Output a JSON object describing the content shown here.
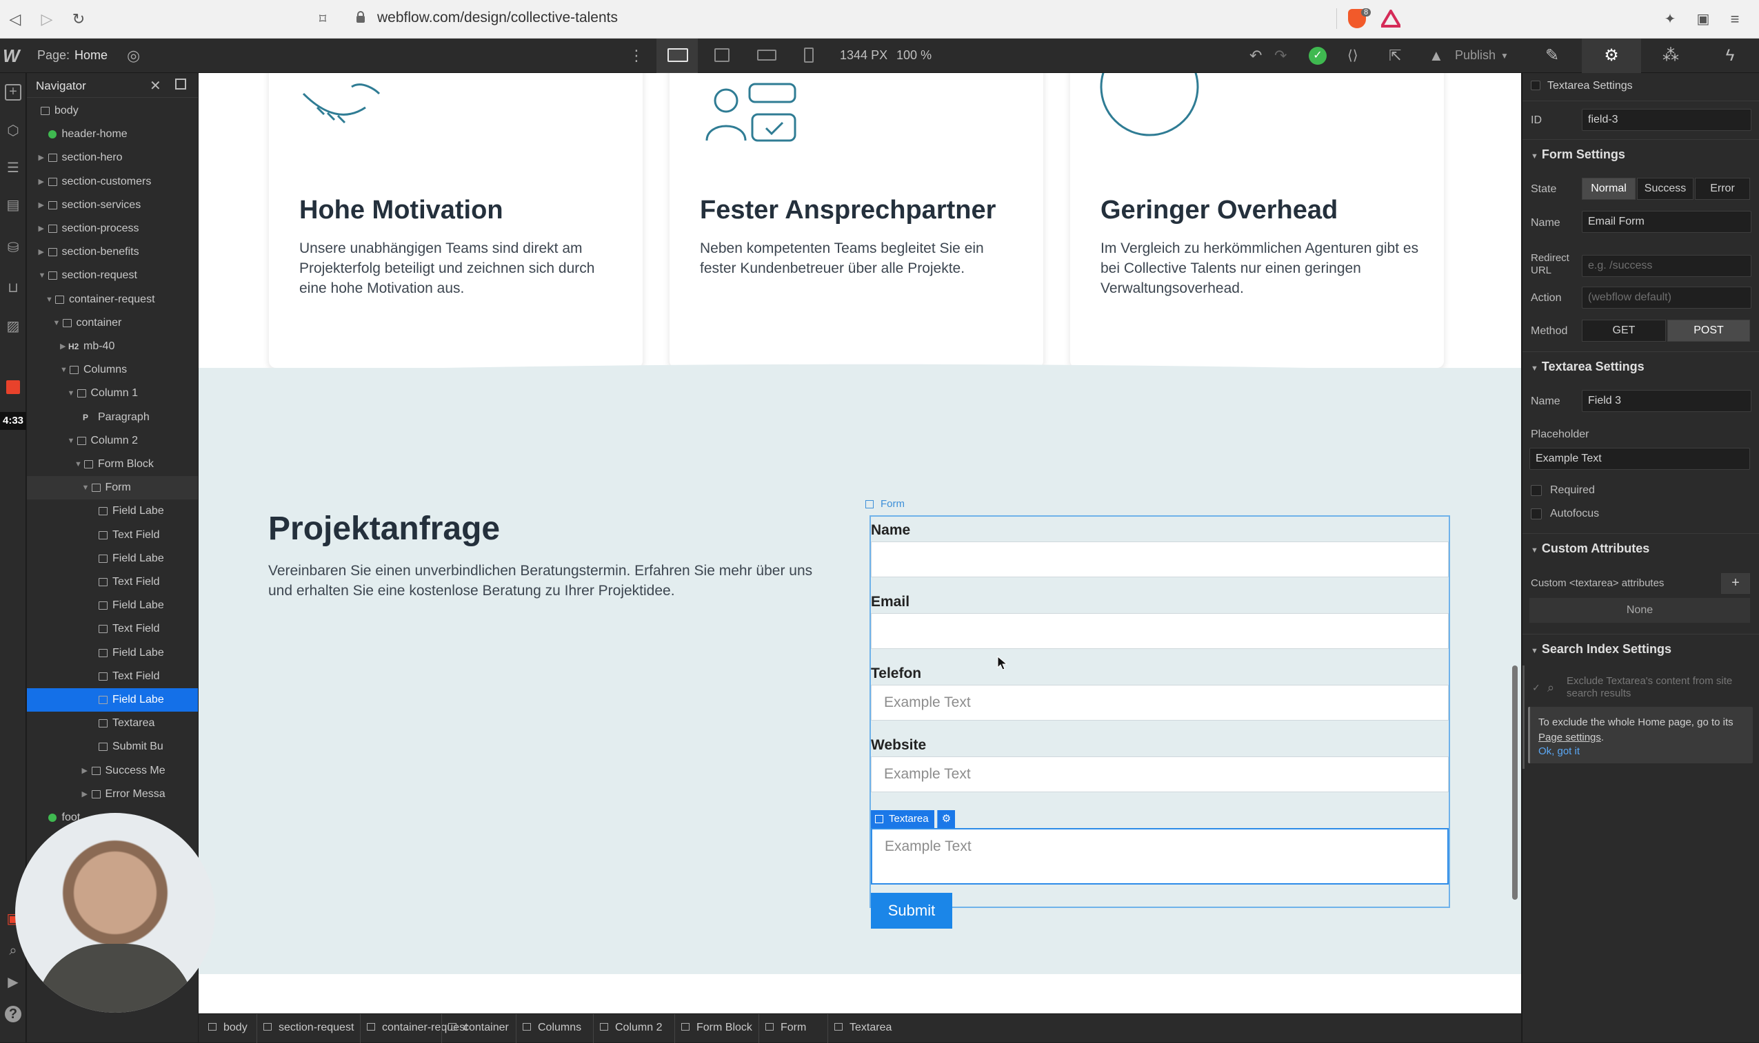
{
  "browser": {
    "url": "webflow.com/design/collective-talents",
    "shield_badge": "8"
  },
  "topbar": {
    "page_prefix": "Page:",
    "page_name": "Home",
    "width": "1344",
    "width_unit": "PX",
    "zoom": "100",
    "zoom_unit": "%",
    "publish": "Publish"
  },
  "timer": "4:33",
  "navigator": {
    "title": "Navigator",
    "items": [
      {
        "label": "body",
        "type": "box"
      },
      {
        "label": "header-home",
        "type": "symbol"
      },
      {
        "label": "section-hero",
        "type": "section"
      },
      {
        "label": "section-customers",
        "type": "section"
      },
      {
        "label": "section-services",
        "type": "section"
      },
      {
        "label": "section-process",
        "type": "section"
      },
      {
        "label": "section-benefits",
        "type": "section"
      },
      {
        "label": "section-request",
        "type": "section"
      },
      {
        "label": "container-request",
        "type": "box"
      },
      {
        "label": "container",
        "type": "container"
      },
      {
        "label": "mb-40",
        "type": "h2",
        "prefix": "H2"
      },
      {
        "label": "Columns",
        "type": "columns"
      },
      {
        "label": "Column 1",
        "type": "column"
      },
      {
        "label": "Paragraph",
        "type": "p",
        "prefix": "P"
      },
      {
        "label": "Column 2",
        "type": "column"
      },
      {
        "label": "Form Block",
        "type": "form"
      },
      {
        "label": "Form",
        "type": "box"
      },
      {
        "label": "Field Labe",
        "type": "label"
      },
      {
        "label": "Text Field",
        "type": "box"
      },
      {
        "label": "Field Labe",
        "type": "label"
      },
      {
        "label": "Text Field",
        "type": "box"
      },
      {
        "label": "Field Labe",
        "type": "label"
      },
      {
        "label": "Text Field",
        "type": "box"
      },
      {
        "label": "Field Labe",
        "type": "label"
      },
      {
        "label": "Text Field",
        "type": "box"
      },
      {
        "label": "Field Labe",
        "type": "label"
      },
      {
        "label": "Textarea",
        "type": "box"
      },
      {
        "label": "Submit Bu",
        "type": "button"
      },
      {
        "label": "Success Me",
        "type": "box"
      },
      {
        "label": "Error Messa",
        "type": "box"
      },
      {
        "label": "foot",
        "type": "symbol"
      }
    ]
  },
  "canvas": {
    "cards": [
      {
        "title": "Hohe Motivation",
        "text": "Unsere unabhängigen Teams sind direkt am Projekterfolg beteiligt und zeichnen sich durch eine hohe Motivation aus."
      },
      {
        "title": "Fester Ansprechpartner",
        "text": "Neben kompetenten Teams begleitet Sie ein fester Kundenbetreuer über alle Projekte."
      },
      {
        "title": "Geringer Overhead",
        "text": "Im Vergleich zu herkömmlichen Agenturen gibt es bei Collective Talents nur einen geringen Verwaltungsoverhead."
      }
    ],
    "request": {
      "title": "Projektanfrage",
      "text": "Vereinbaren Sie einen unverbindlichen Beratungstermin. Erfahren Sie mehr über uns und erhalten Sie eine kostenlose Beratung zu Ihrer Projektidee.",
      "form_tag": "Form",
      "fields": [
        {
          "label": "Name",
          "placeholder": ""
        },
        {
          "label": "Email",
          "placeholder": ""
        },
        {
          "label": "Telefon",
          "placeholder": "Example Text"
        },
        {
          "label": "Website",
          "placeholder": "Example Text"
        }
      ],
      "textarea_badge": "Textarea",
      "textarea_placeholder": "Example Text",
      "submit": "Submit"
    }
  },
  "breadcrumbs": [
    "body",
    "section-request",
    "container-request",
    "container",
    "Columns",
    "Column 2",
    "Form Block",
    "Form",
    "Textarea"
  ],
  "panel": {
    "header": "Textarea Settings",
    "id_label": "ID",
    "id_value": "field-3",
    "form_settings": "Form Settings",
    "state_label": "State",
    "states": [
      "Normal",
      "Success",
      "Error"
    ],
    "name_label": "Name",
    "form_name": "Email Form",
    "redirect_label_1": "Redirect",
    "redirect_label_2": "URL",
    "redirect_placeholder": "e.g. /success",
    "action_label": "Action",
    "action_placeholder": "(webflow default)",
    "method_label": "Method",
    "methods": [
      "GET",
      "POST"
    ],
    "textarea_settings": "Textarea Settings",
    "ta_name_label": "Name",
    "ta_name": "Field 3",
    "placeholder_label": "Placeholder",
    "placeholder_value": "Example Text",
    "required": "Required",
    "autofocus": "Autofocus",
    "custom_attributes": "Custom Attributes",
    "custom_attr_text": "Custom <textarea> attributes",
    "custom_attr_none": "None",
    "search_index": "Search Index Settings",
    "exclude_text": "Exclude Textarea's content from site search results",
    "info_text_1": "To exclude the whole Home page, go to its",
    "info_link": "Page settings",
    "info_text_2": ".",
    "ok_link": "Ok, got it"
  },
  "colors": {
    "accent": "#1b86e8",
    "selection": "#1470e8",
    "section_bg": "#e3edef",
    "panel_bg": "#2b2b2b"
  }
}
